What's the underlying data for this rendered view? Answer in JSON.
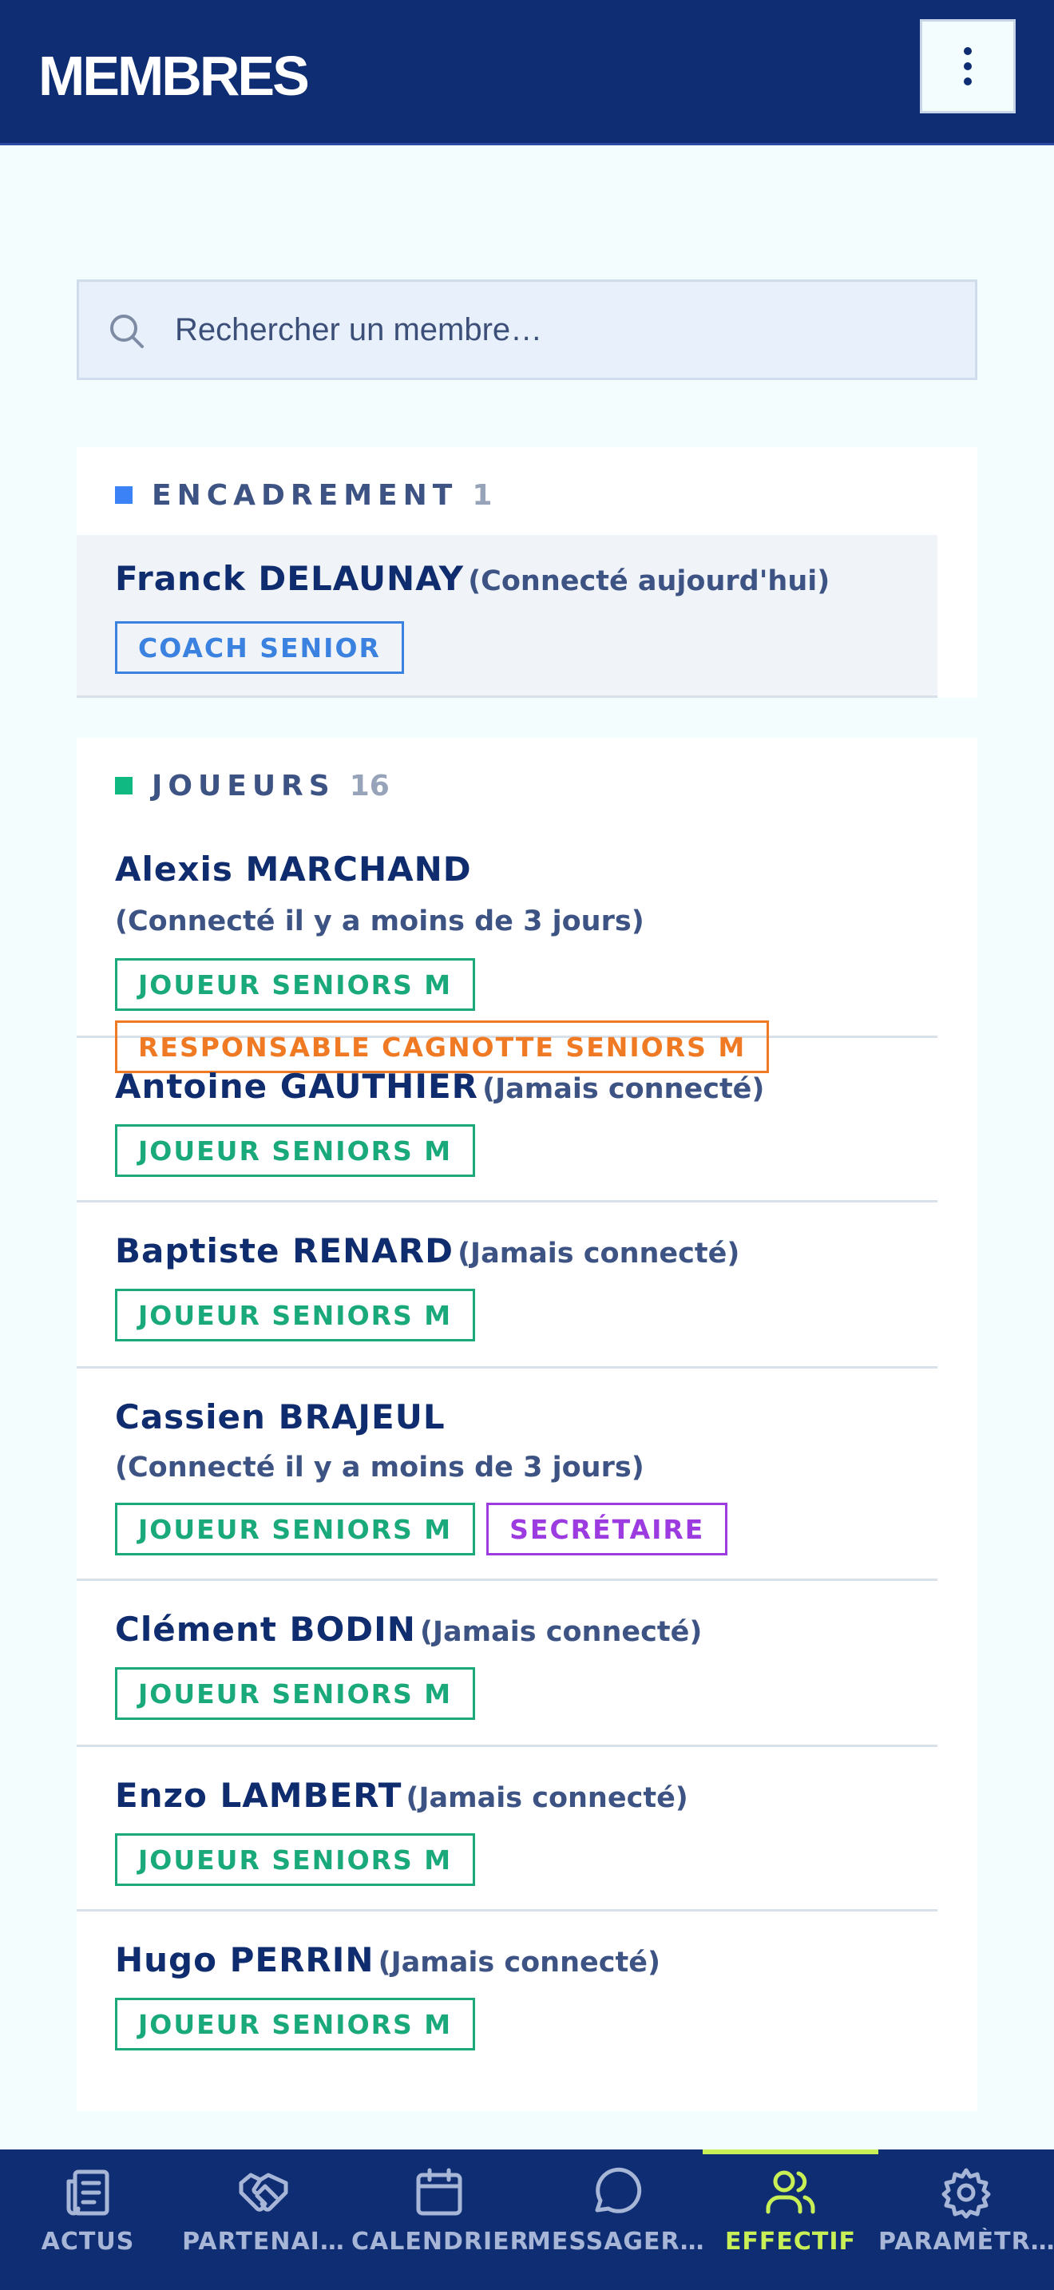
{
  "header": {
    "title": "MEMBRES",
    "menu_icon": "more-vertical-icon"
  },
  "search": {
    "placeholder": "Rechercher un membre…",
    "icon": "search-icon"
  },
  "sections": [
    {
      "title": "ENCADREMENT",
      "count": "1",
      "color": "#3b82f6",
      "members": [
        {
          "name": "Franck DELAUNAY",
          "status": "(Connecté aujourd'hui)",
          "badges": [
            {
              "label": "COACH SENIOR",
              "color": "#3b82e0"
            }
          ]
        }
      ]
    },
    {
      "title": "JOUEURS",
      "count": "16",
      "color": "#10b981",
      "members": [
        {
          "name": "Alexis MARCHAND",
          "status": "(Connecté il y a moins de 3 jours)",
          "badges": [
            {
              "label": "JOUEUR SENIORS M",
              "color": "#19a97a"
            },
            {
              "label": "RESPONSABLE CAGNOTTE SENIORS M",
              "color": "#f07a24"
            }
          ]
        },
        {
          "name": "Antoine GAUTHIER",
          "status": "(Jamais connecté)",
          "badges": [
            {
              "label": "JOUEUR SENIORS M",
              "color": "#19a97a"
            }
          ]
        },
        {
          "name": "Baptiste RENARD",
          "status": "(Jamais connecté)",
          "badges": [
            {
              "label": "JOUEUR SENIORS M",
              "color": "#19a97a"
            }
          ]
        },
        {
          "name": "Cassien BRAJEUL",
          "status": "(Connecté il y a moins de 3 jours)",
          "badges": [
            {
              "label": "JOUEUR SENIORS M",
              "color": "#19a97a"
            },
            {
              "label": "SECRÉTAIRE",
              "color": "#9b3be0"
            }
          ]
        },
        {
          "name": "Clément BODIN",
          "status": "(Jamais connecté)",
          "badges": [
            {
              "label": "JOUEUR SENIORS M",
              "color": "#19a97a"
            }
          ]
        },
        {
          "name": "Enzo LAMBERT",
          "status": "(Jamais connecté)",
          "badges": [
            {
              "label": "JOUEUR SENIORS M",
              "color": "#19a97a"
            }
          ]
        },
        {
          "name": "Hugo PERRIN",
          "status": "(Jamais connecté)",
          "badges": [
            {
              "label": "JOUEUR SENIORS M",
              "color": "#19a97a"
            }
          ]
        }
      ]
    }
  ],
  "bottom_nav": {
    "active": "EFFECTIF",
    "items": [
      {
        "label": "ACTUS",
        "icon": "newspaper-icon"
      },
      {
        "label": "PARTENAI…",
        "icon": "handshake-icon"
      },
      {
        "label": "CALENDRIER",
        "icon": "calendar-icon"
      },
      {
        "label": "MESSAGER…",
        "icon": "chat-bubble-icon"
      },
      {
        "label": "EFFECTIF",
        "icon": "users-icon"
      },
      {
        "label": "PARAMÈTR…",
        "icon": "gear-icon"
      }
    ]
  },
  "colors": {
    "primary": "#0f2d73",
    "accent": "#c8f056",
    "background": "#f4fdfd"
  }
}
